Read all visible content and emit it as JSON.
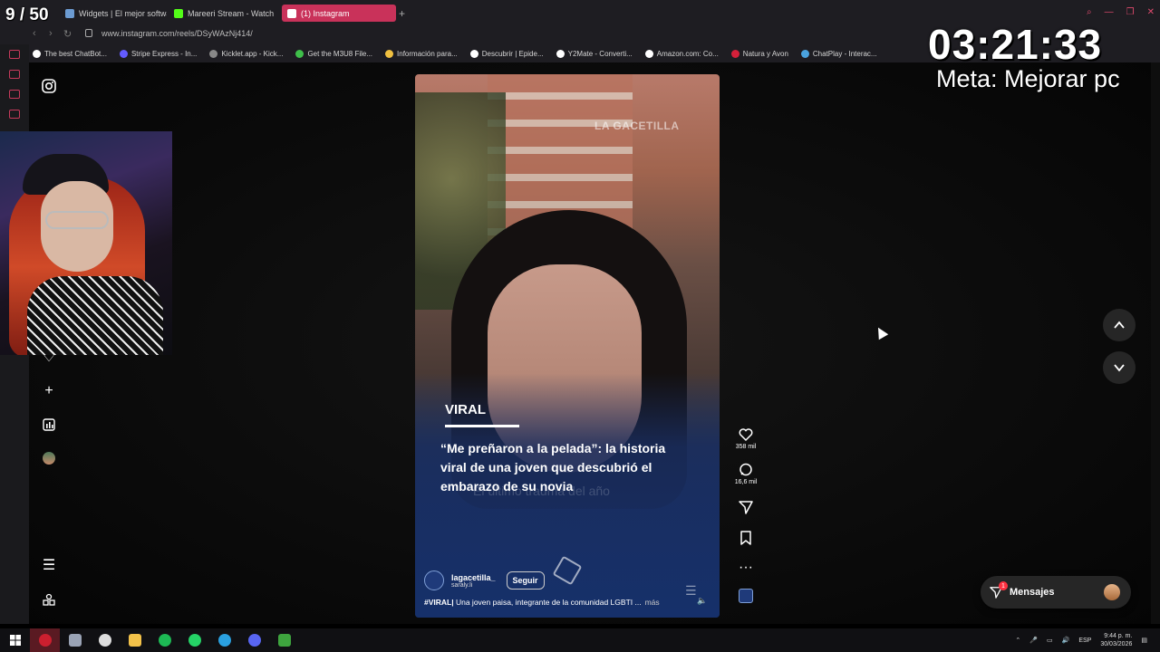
{
  "overlay": {
    "counter": "9 / 50",
    "timer": "03:21:33",
    "goal": "Meta: Mejorar pc"
  },
  "browser": {
    "tabs": [
      {
        "label": "Widgets | El mejor softwa",
        "color": "#6c9bd2"
      },
      {
        "label": "Mareeri Stream - Watch L",
        "color": "#53fc18"
      },
      {
        "label": "(1) Instagram",
        "color": "#e1306c"
      }
    ],
    "url": "www.instagram.com/reels/DSyWAzNj414/",
    "bookmarks": [
      {
        "label": "The best ChatBot...",
        "color": "#ffffff"
      },
      {
        "label": "Stripe Express - In...",
        "color": "#635bff"
      },
      {
        "label": "Kicklet.app - Kick...",
        "color": "#888888"
      },
      {
        "label": "Get the M3U8 File...",
        "color": "#3fbf4a"
      },
      {
        "label": "Información para...",
        "color": "#f0c040"
      },
      {
        "label": "Descubrir | Epide...",
        "color": "#ffffff"
      },
      {
        "label": "Y2Mate - Converti...",
        "color": "#ffffff"
      },
      {
        "label": "Amazon.com: Co...",
        "color": "#ffffff"
      },
      {
        "label": "Natura y Avon",
        "color": "#d4203a"
      },
      {
        "label": "ChatPlay - Interac...",
        "color": "#4aa3df"
      }
    ]
  },
  "reel": {
    "watermark": "LA GACETILLA",
    "tag": "VIRAL",
    "headline": "“Me preñaron a la pelada”: la historia viral de una joven que descubrió el embarazo de su novia",
    "ghost_text": "El último trauma del año",
    "username": "lagacetilla_",
    "collaborator": "saraly.li",
    "follow_label": "Seguir",
    "caption_hashtag": "#VIRAL|",
    "caption_text": " Una joven paisa, integrante de la comunidad LGBTI ...",
    "more_label": "más"
  },
  "actions": {
    "likes": "358 mil",
    "comments": "16,6 mil"
  },
  "messages": {
    "label": "Mensajes",
    "badge": "1"
  },
  "taskbar": {
    "lang": "ESP",
    "time": "9:44 p. m.",
    "date": "30/03/2026"
  }
}
